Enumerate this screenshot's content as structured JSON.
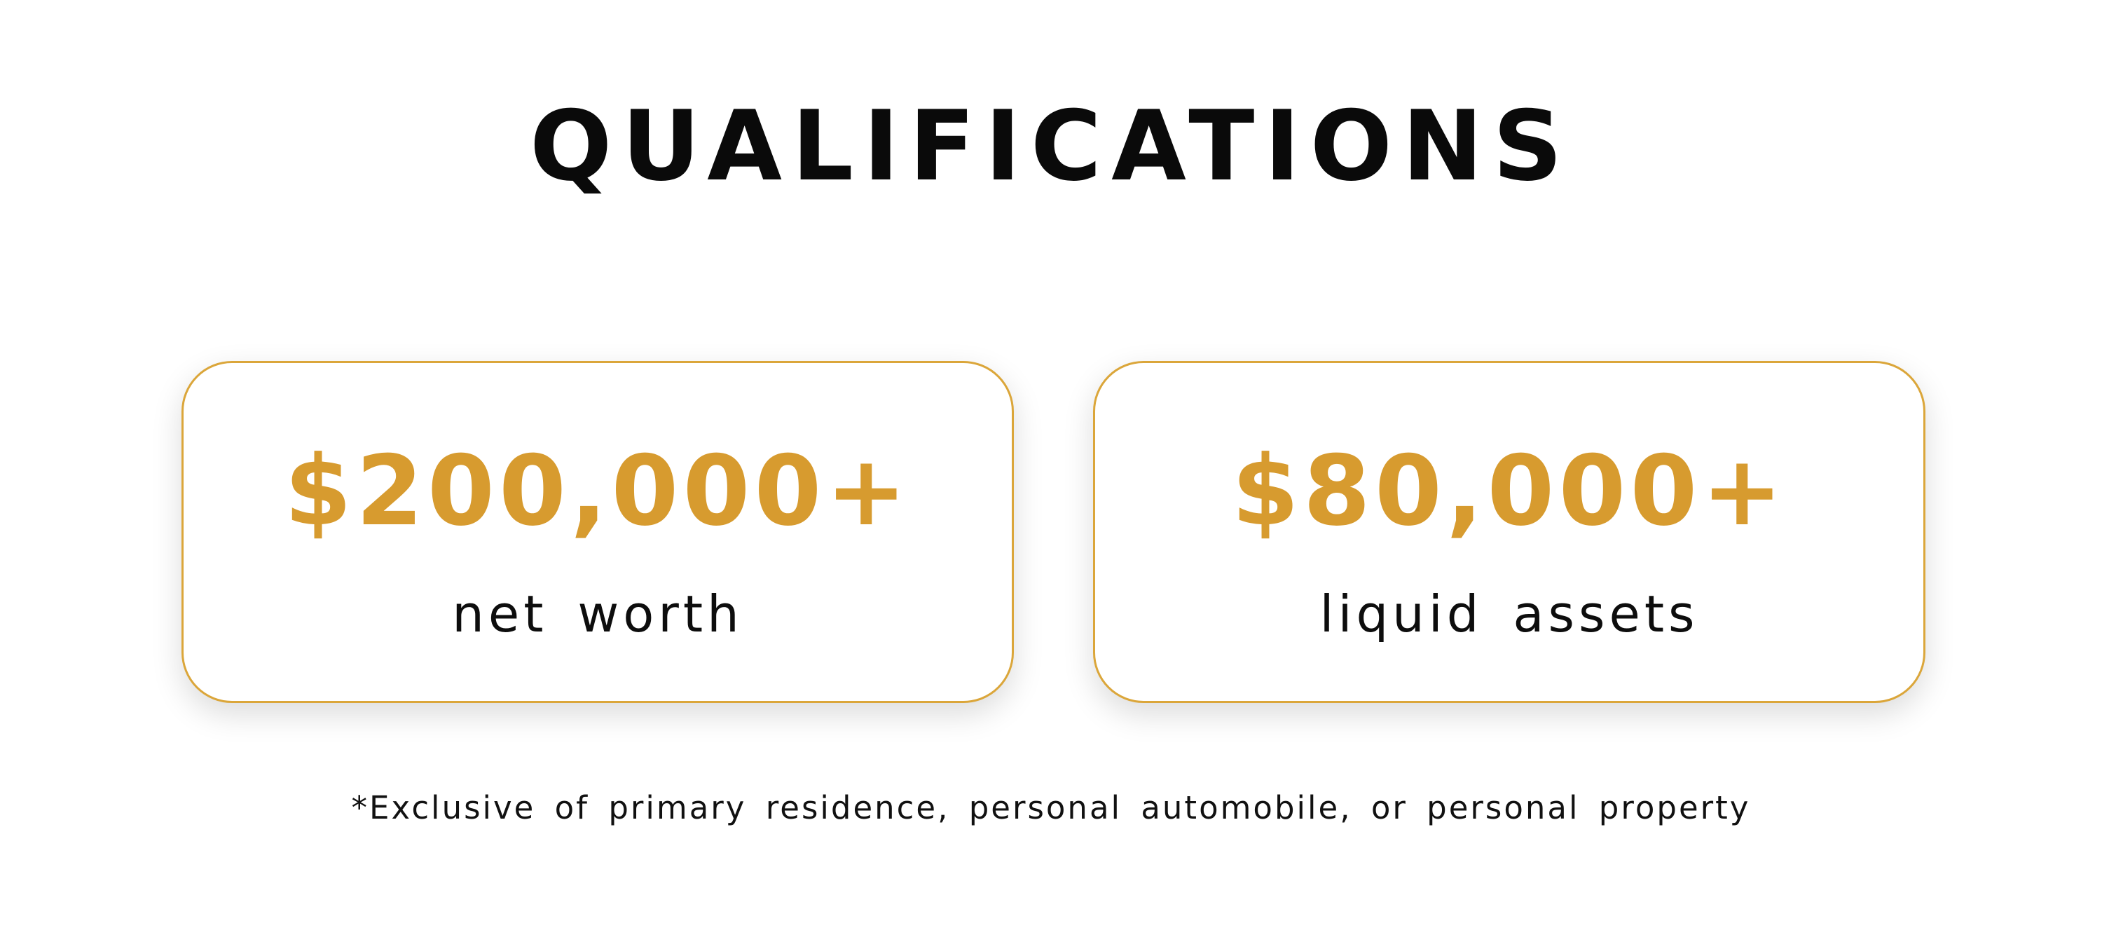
{
  "title": "QUALIFICATIONS",
  "cards": [
    {
      "value": "$200,000+",
      "label": "net worth"
    },
    {
      "value": "$80,000+",
      "label": "liquid assets"
    }
  ],
  "footnote": "*Exclusive of primary residence, personal automobile, or personal property",
  "colors": {
    "accent": "#d79b2f",
    "border": "#dba63a",
    "text": "#0a0a0a",
    "background": "#ffffff"
  }
}
